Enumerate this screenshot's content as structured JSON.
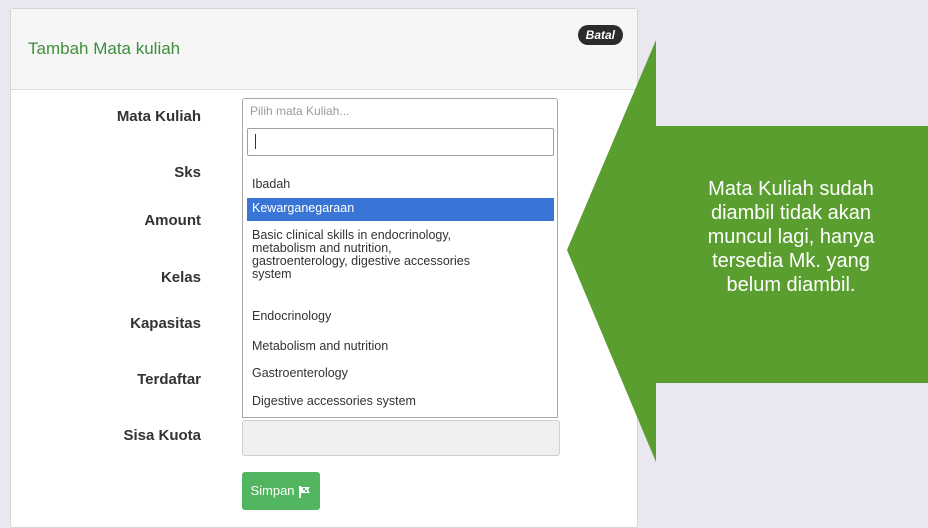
{
  "header": {
    "title": "Tambah Mata kuliah",
    "close_label": "Batal"
  },
  "form": {
    "labels": {
      "mata_kuliah": "Mata Kuliah",
      "sks": "Sks",
      "amount": "Amount",
      "kelas": "Kelas",
      "kapasitas": "Kapasitas",
      "terdaftar": "Terdaftar",
      "sisa_kuota": "Sisa Kuota"
    },
    "select_placeholder": "Pilih mata Kuliah...",
    "search_value": "",
    "options": [
      {
        "lines": [
          "Ibadah"
        ]
      },
      {
        "lines": [
          "Kewarganegaraan"
        ],
        "selected": true
      },
      {
        "lines": [
          "Basic clinical skills in endocrinology,",
          "metabolism and nutrition,",
          "gastroenterology, digestive accessories",
          "system"
        ]
      },
      {
        "lines": [
          "Endocrinology"
        ]
      },
      {
        "lines": [
          "Metabolism and nutrition"
        ]
      },
      {
        "lines": [
          "Gastroenterology"
        ]
      },
      {
        "lines": [
          "Digestive accessories system"
        ]
      }
    ],
    "save_label": "Simpan"
  },
  "callout": {
    "lines": [
      "Mata Kuliah sudah",
      "diambil tidak akan",
      "muncul lagi, hanya",
      "tersedia Mk. yang",
      "belum diambil."
    ],
    "color": "#5a9e2f"
  },
  "colors": {
    "accent_green": "#3f8f3a",
    "highlight_blue": "#3875d7",
    "save_green": "#52b55f"
  }
}
